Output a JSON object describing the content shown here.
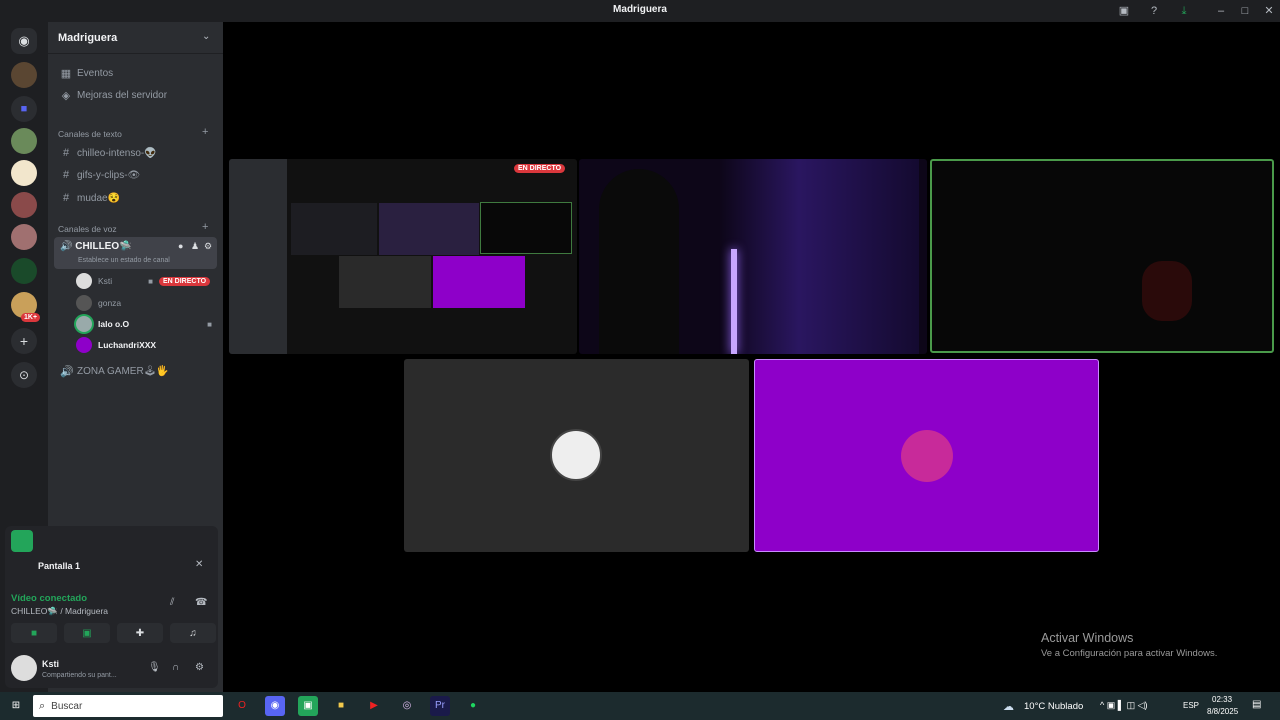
{
  "window": {
    "title": "Madriguera"
  },
  "rail": {
    "badge": "1K+"
  },
  "server": {
    "name": "Madriguera",
    "menu": [
      {
        "label": "Eventos"
      },
      {
        "label": "Mejoras del servidor"
      }
    ],
    "text_category": "Canales de texto",
    "text_channels": [
      {
        "label": "chilleo-intenso-👽"
      },
      {
        "label": "gifs-y-clips-👁"
      },
      {
        "label": "mudae😵"
      }
    ],
    "voice_category": "Canales de voz",
    "voice_channel": {
      "label": "CHILLEO🛸",
      "status": "Establece un estado de canal"
    },
    "voice_users": [
      {
        "name": "Ksti",
        "live": "EN DIRECTO"
      },
      {
        "name": "gonza"
      },
      {
        "name": "lalo o.O"
      },
      {
        "name": "LuchandriXXX"
      }
    ],
    "voice_channel2": {
      "label": "ZONA GAMER🕹🖐"
    }
  },
  "panel": {
    "stream": "Pantalla 1",
    "status": "Vídeo conectado",
    "channel": "CHILLEO🛸 / Madriguera",
    "user": "Ksti",
    "user_status": "Compartiendo su pant..."
  },
  "stage": {
    "live_badge": "EN DIRECTO"
  },
  "watermark": {
    "line1": "Activar Windows",
    "line2": "Ve a Configuración para activar Windows."
  },
  "taskbar": {
    "search": "Buscar",
    "weather": "10°C  Nublado",
    "lang": "ESP",
    "time": "02:33",
    "date": "8/8/2025"
  }
}
